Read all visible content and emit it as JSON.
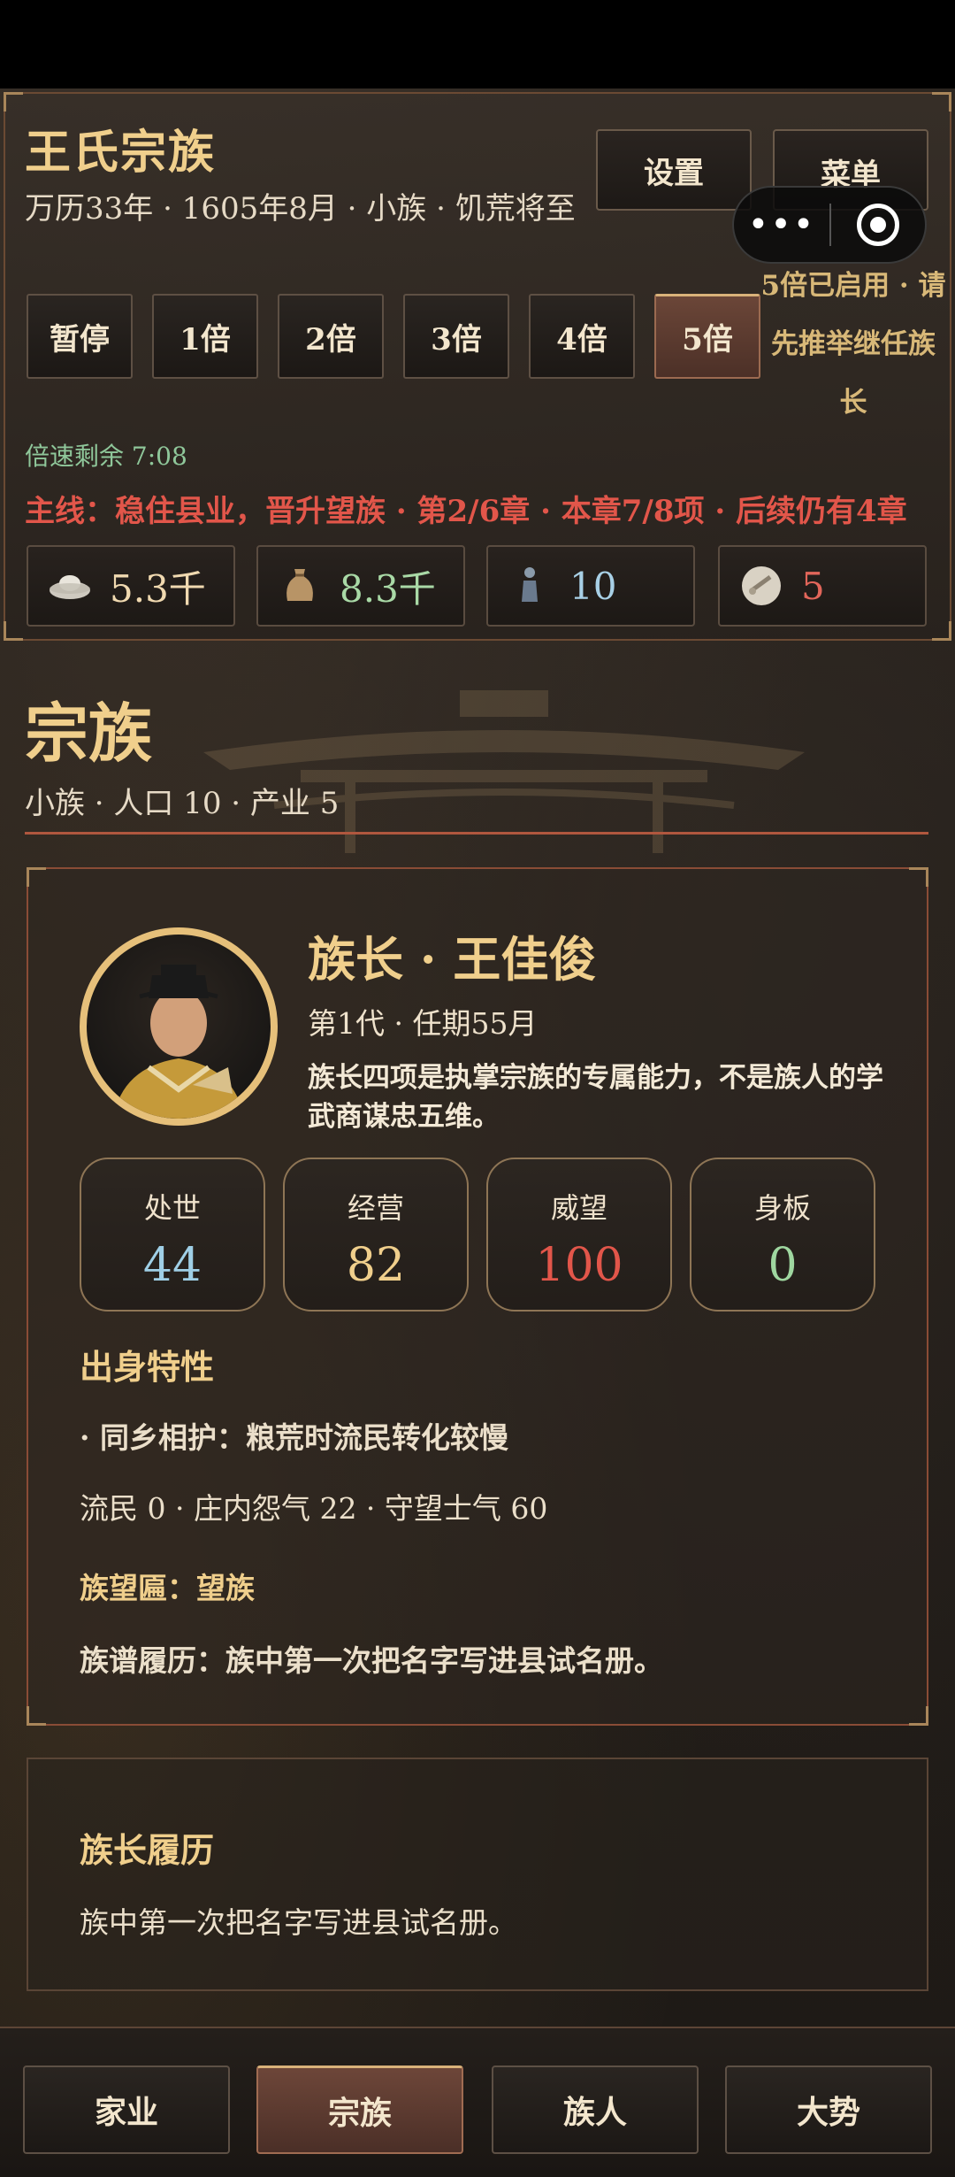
{
  "header": {
    "title": "王氏宗族",
    "subtitle": "万历33年 · 1605年8月 · 小族 · 饥荒将至",
    "settings_label": "设置",
    "menu_label": "菜单",
    "capsule_dots": "•••",
    "speed_buttons": [
      "暂停",
      "1倍",
      "2倍",
      "3倍",
      "4倍",
      "5倍"
    ],
    "active_speed": "5倍",
    "speed_note": "5倍已启用 · 请先推举继任族长",
    "speed_remaining": "倍速剩余 7:08",
    "mainline": "主线：稳住县业，晋升望族 · 第2/6章 · 本章7/8项 · 后续仍有4章"
  },
  "resources": [
    {
      "icon": "silver-ingot-icon",
      "value": "5.3千",
      "color": "#f0d9b0"
    },
    {
      "icon": "grain-sack-icon",
      "value": "8.3千",
      "color": "#a9d9a6"
    },
    {
      "icon": "person-icon",
      "value": "10",
      "color": "#a8d0e6"
    },
    {
      "icon": "scroll-icon",
      "value": "5",
      "color": "#e2665a"
    }
  ],
  "section": {
    "title": "宗族",
    "subtitle": "小族 · 人口 10 · 产业 5"
  },
  "chief": {
    "name": "族长 · 王佳俊",
    "meta": "第1代 · 任期55月",
    "desc": "族长四项是执掌宗族的专属能力，不是族人的学武商谋忠五维。",
    "stats": [
      {
        "label": "处世",
        "value": "44",
        "color": "#9fcfe6"
      },
      {
        "label": "经营",
        "value": "82",
        "color": "#f0cf8c"
      },
      {
        "label": "威望",
        "value": "100",
        "color": "#e2564a"
      },
      {
        "label": "身板",
        "value": "0",
        "color": "#9fd7a0"
      }
    ],
    "traits_title": "出身特性",
    "trait_line": "· 同乡相护：粮荒时流民转化较慢",
    "status_line": "流民 0 · 庄内怨气 22 · 守望士气 60",
    "plaque": "族望匾：望族",
    "genealogy": "族谱履历：族中第一次把名字写进县试名册。"
  },
  "history": {
    "title": "族长履历",
    "text": "族中第一次把名字写进县试名册。"
  },
  "nav": {
    "tabs": [
      "家业",
      "宗族",
      "族人",
      "大势"
    ],
    "active": "宗族"
  }
}
